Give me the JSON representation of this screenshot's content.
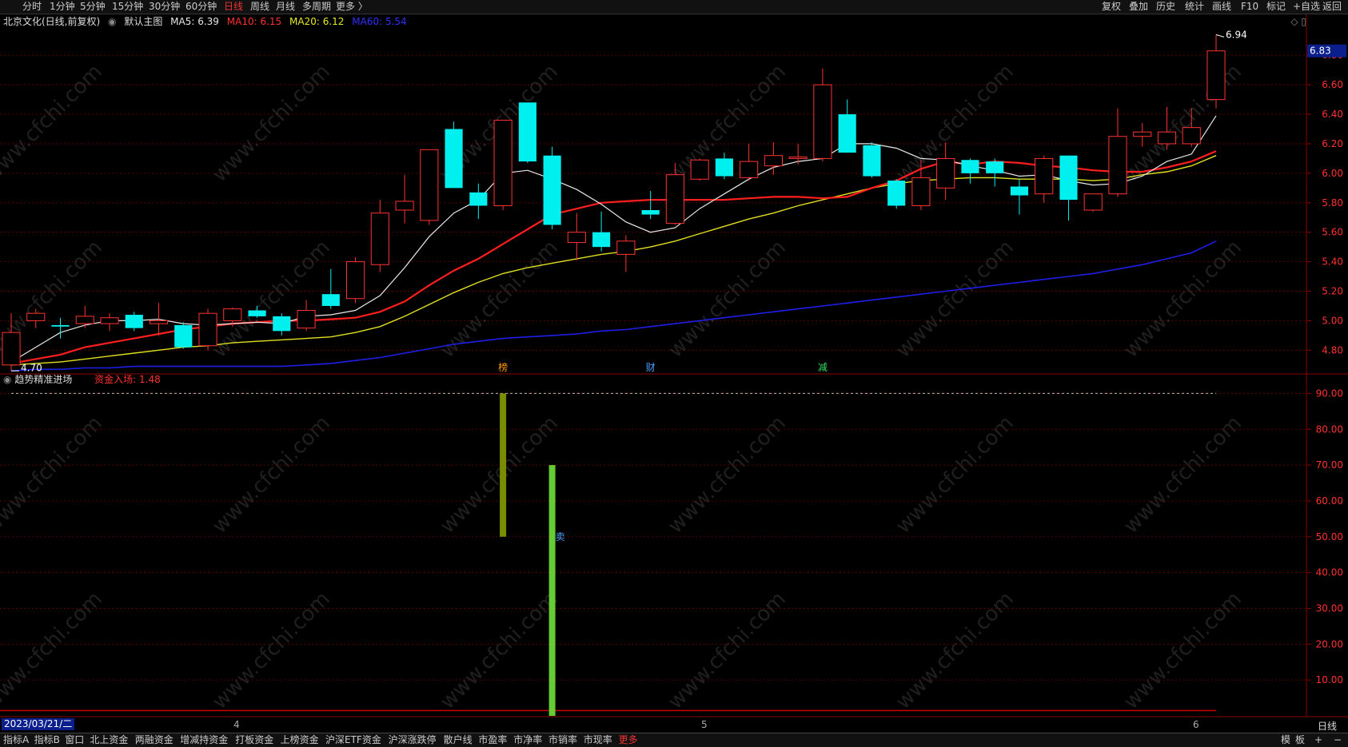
{
  "toolbar": {
    "periods": [
      "分时",
      "1分钟",
      "5分钟",
      "15分钟",
      "30分钟",
      "60分钟",
      "日线",
      "周线",
      "月线",
      "多周期",
      "更多 〉"
    ],
    "active_period": "日线",
    "right_items": [
      "复权",
      "叠加",
      "历史",
      "统计",
      "画线",
      "F10",
      "标记",
      "+自选",
      "返回"
    ]
  },
  "main_header": {
    "stock": "北京文化(日线,前复权)",
    "template": "默认主图",
    "ma5": "MA5: 6.39",
    "ma10": "MA10: 6.15",
    "ma20": "MA20: 6.12",
    "ma60": "MA60: 5.54"
  },
  "sub_header": {
    "indicator": "趋势精准进场",
    "value": "资金入场: 1.48"
  },
  "colors": {
    "up": "#ff3232",
    "down": "#00f0f0",
    "ma5": "#e8e8e8",
    "ma10": "#ff1e1e",
    "ma20": "#e0e020",
    "ma60": "#1e1ee8",
    "grid": "#5a0000",
    "bar_olive": "#7a8c00",
    "bar_green": "#66cc33"
  },
  "price_axis": [
    "6.80",
    "6.60",
    "6.40",
    "6.20",
    "6.00",
    "5.80",
    "5.60",
    "5.40",
    "5.20",
    "5.00",
    "4.80"
  ],
  "price_current": "6.83",
  "high_label": "6.94",
  "low_label": "4.70",
  "markers": {
    "bang": "榜",
    "cai": "财",
    "jian": "减",
    "mai": "卖"
  },
  "sub_axis": [
    "90.00",
    "80.00",
    "70.00",
    "60.00",
    "50.00",
    "40.00",
    "30.00",
    "20.00",
    "10.00"
  ],
  "date_bar": {
    "start": "2023/03/21/二",
    "months": [
      "4",
      "5",
      "6"
    ],
    "period_label": "日线"
  },
  "bottom_tabs": [
    "指标A",
    "指标B",
    "窗口",
    "北上资金",
    "两融资金",
    "增减持资金",
    "打板资金",
    "上榜资金",
    "沪深ETF资金",
    "沪深涨跌停",
    "散户线",
    "市盈率",
    "市净率",
    "市销率",
    "市现率",
    "更多"
  ],
  "bottom_right": [
    "模",
    "板",
    "+",
    "−"
  ],
  "watermark": "www.cfchi.com",
  "chart_data": {
    "type": "candlestick",
    "title": "北京文化(日线,前复权)",
    "ylim": [
      4.65,
      6.98
    ],
    "candles": [
      {
        "o": 4.7,
        "h": 5.05,
        "l": 4.66,
        "c": 4.92
      },
      {
        "o": 5.0,
        "h": 5.08,
        "l": 4.95,
        "c": 5.05
      },
      {
        "o": 4.97,
        "h": 5.02,
        "l": 4.88,
        "c": 4.96
      },
      {
        "o": 4.98,
        "h": 5.1,
        "l": 4.95,
        "c": 5.03
      },
      {
        "o": 4.98,
        "h": 5.05,
        "l": 4.93,
        "c": 5.02
      },
      {
        "o": 5.04,
        "h": 5.06,
        "l": 4.93,
        "c": 4.95
      },
      {
        "o": 4.98,
        "h": 5.12,
        "l": 4.9,
        "c": 5.0
      },
      {
        "o": 4.97,
        "h": 4.99,
        "l": 4.81,
        "c": 4.82
      },
      {
        "o": 4.83,
        "h": 5.08,
        "l": 4.8,
        "c": 5.05
      },
      {
        "o": 5.0,
        "h": 5.09,
        "l": 4.96,
        "c": 5.08
      },
      {
        "o": 5.07,
        "h": 5.1,
        "l": 5.02,
        "c": 5.03
      },
      {
        "o": 5.03,
        "h": 5.05,
        "l": 4.9,
        "c": 4.93
      },
      {
        "o": 4.95,
        "h": 5.14,
        "l": 4.93,
        "c": 5.07
      },
      {
        "o": 5.18,
        "h": 5.35,
        "l": 5.08,
        "c": 5.1
      },
      {
        "o": 5.15,
        "h": 5.43,
        "l": 5.12,
        "c": 5.4
      },
      {
        "o": 5.38,
        "h": 5.82,
        "l": 5.33,
        "c": 5.73
      },
      {
        "o": 5.75,
        "h": 5.99,
        "l": 5.66,
        "c": 5.81
      },
      {
        "o": 5.68,
        "h": 6.16,
        "l": 5.65,
        "c": 6.16
      },
      {
        "o": 6.3,
        "h": 6.35,
        "l": 5.9,
        "c": 5.9
      },
      {
        "o": 5.87,
        "h": 5.93,
        "l": 5.69,
        "c": 5.78
      },
      {
        "o": 5.78,
        "h": 6.36,
        "l": 5.75,
        "c": 6.36
      },
      {
        "o": 6.48,
        "h": 6.48,
        "l": 6.07,
        "c": 6.08
      },
      {
        "o": 6.12,
        "h": 6.18,
        "l": 5.62,
        "c": 5.65
      },
      {
        "o": 5.53,
        "h": 5.73,
        "l": 5.41,
        "c": 5.6
      },
      {
        "o": 5.6,
        "h": 5.74,
        "l": 5.47,
        "c": 5.5
      },
      {
        "o": 5.45,
        "h": 5.58,
        "l": 5.33,
        "c": 5.54
      },
      {
        "o": 5.75,
        "h": 5.88,
        "l": 5.69,
        "c": 5.72
      },
      {
        "o": 5.66,
        "h": 6.07,
        "l": 5.65,
        "c": 5.99
      },
      {
        "o": 5.96,
        "h": 6.1,
        "l": 5.95,
        "c": 6.09
      },
      {
        "o": 6.1,
        "h": 6.14,
        "l": 5.96,
        "c": 5.98
      },
      {
        "o": 5.97,
        "h": 6.2,
        "l": 5.95,
        "c": 6.08
      },
      {
        "o": 6.05,
        "h": 6.21,
        "l": 5.99,
        "c": 6.12
      },
      {
        "o": 6.1,
        "h": 6.2,
        "l": 6.06,
        "c": 6.11
      },
      {
        "o": 6.1,
        "h": 6.71,
        "l": 6.08,
        "c": 6.6
      },
      {
        "o": 6.4,
        "h": 6.5,
        "l": 6.15,
        "c": 6.14
      },
      {
        "o": 6.19,
        "h": 6.21,
        "l": 5.97,
        "c": 5.98
      },
      {
        "o": 5.95,
        "h": 5.96,
        "l": 5.76,
        "c": 5.78
      },
      {
        "o": 5.78,
        "h": 6.09,
        "l": 5.75,
        "c": 5.97
      },
      {
        "o": 5.9,
        "h": 6.21,
        "l": 5.82,
        "c": 6.1
      },
      {
        "o": 6.09,
        "h": 6.1,
        "l": 5.93,
        "c": 6.0
      },
      {
        "o": 6.08,
        "h": 6.1,
        "l": 5.91,
        "c": 6.0
      },
      {
        "o": 5.91,
        "h": 5.96,
        "l": 5.72,
        "c": 5.85
      },
      {
        "o": 5.86,
        "h": 6.12,
        "l": 5.8,
        "c": 6.1
      },
      {
        "o": 6.12,
        "h": 6.12,
        "l": 5.68,
        "c": 5.82
      },
      {
        "o": 5.75,
        "h": 5.86,
        "l": 5.74,
        "c": 5.86
      },
      {
        "o": 5.86,
        "h": 6.44,
        "l": 5.84,
        "c": 6.25
      },
      {
        "o": 6.25,
        "h": 6.34,
        "l": 6.18,
        "c": 6.28
      },
      {
        "o": 6.2,
        "h": 6.45,
        "l": 6.16,
        "c": 6.28
      },
      {
        "o": 6.2,
        "h": 6.44,
        "l": 6.18,
        "c": 6.31
      },
      {
        "o": 6.5,
        "h": 6.94,
        "l": 6.44,
        "c": 6.83
      }
    ],
    "ma5": [
      4.72,
      4.82,
      4.92,
      4.97,
      5.0,
      5.0,
      5.01,
      4.98,
      4.97,
      4.98,
      4.99,
      4.98,
      5.03,
      5.04,
      5.07,
      5.17,
      5.36,
      5.57,
      5.73,
      5.82,
      6.0,
      6.02,
      5.96,
      5.89,
      5.79,
      5.67,
      5.6,
      5.63,
      5.76,
      5.86,
      5.96,
      6.04,
      6.08,
      6.1,
      6.2,
      6.2,
      6.17,
      6.1,
      6.09,
      6.05,
      6.02,
      5.98,
      5.99,
      5.95,
      5.92,
      5.93,
      5.98,
      6.08,
      6.13,
      6.39
    ],
    "ma10": [
      4.71,
      4.74,
      4.77,
      4.82,
      4.85,
      4.88,
      4.91,
      4.94,
      4.96,
      4.98,
      4.99,
      5.0,
      5.0,
      5.01,
      5.02,
      5.06,
      5.13,
      5.24,
      5.34,
      5.42,
      5.52,
      5.62,
      5.72,
      5.76,
      5.8,
      5.81,
      5.82,
      5.82,
      5.82,
      5.82,
      5.83,
      5.84,
      5.84,
      5.83,
      5.84,
      5.9,
      5.95,
      6.03,
      6.08,
      6.06,
      6.08,
      6.07,
      6.05,
      6.04,
      6.02,
      6.01,
      6.01,
      6.04,
      6.08,
      6.15
    ],
    "ma20": [
      4.7,
      4.71,
      4.72,
      4.74,
      4.76,
      4.78,
      4.8,
      4.82,
      4.83,
      4.85,
      4.86,
      4.87,
      4.88,
      4.89,
      4.92,
      4.96,
      5.03,
      5.11,
      5.19,
      5.26,
      5.32,
      5.36,
      5.39,
      5.42,
      5.45,
      5.47,
      5.5,
      5.54,
      5.59,
      5.64,
      5.69,
      5.73,
      5.78,
      5.82,
      5.86,
      5.9,
      5.93,
      5.95,
      5.96,
      5.97,
      5.97,
      5.96,
      5.96,
      5.96,
      5.95,
      5.96,
      5.99,
      6.01,
      6.05,
      6.12
    ],
    "ma60": [
      4.66,
      4.67,
      4.67,
      4.68,
      4.68,
      4.69,
      4.69,
      4.69,
      4.69,
      4.69,
      4.69,
      4.69,
      4.7,
      4.71,
      4.73,
      4.75,
      4.78,
      4.81,
      4.84,
      4.86,
      4.88,
      4.89,
      4.9,
      4.91,
      4.93,
      4.94,
      4.96,
      4.98,
      5.0,
      5.02,
      5.04,
      5.06,
      5.08,
      5.1,
      5.12,
      5.14,
      5.16,
      5.18,
      5.2,
      5.22,
      5.24,
      5.26,
      5.28,
      5.3,
      5.32,
      5.35,
      5.38,
      5.42,
      5.46,
      5.54
    ],
    "sub": {
      "ylim": [
        0,
        95
      ],
      "dashed_level": 90,
      "bars": [
        {
          "index": 20,
          "from": 50,
          "to": 90,
          "color": "olive"
        },
        {
          "index": 22,
          "from": 0,
          "to": 70,
          "color": "green"
        }
      ],
      "baseline_value": 1.48
    }
  }
}
